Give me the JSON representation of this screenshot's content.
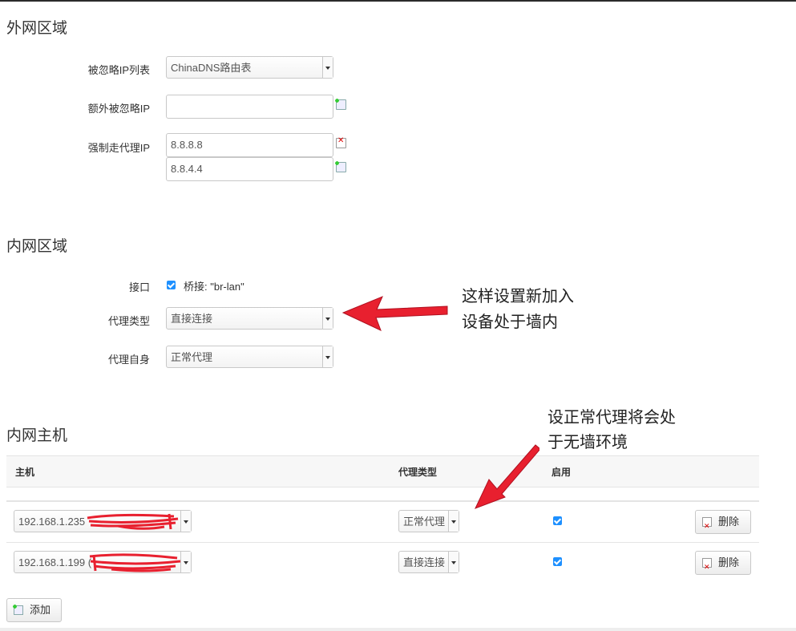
{
  "wan_zone": {
    "title": "外网区域",
    "ignored_ip_list_label": "被忽略IP列表",
    "ignored_ip_list_value": "ChinaDNS路由表",
    "extra_ignored_ip_label": "额外被忽略IP",
    "extra_ignored_ip_value": "",
    "force_proxy_ip_label": "强制走代理IP",
    "force_proxy_ips": [
      "8.8.8.8",
      "8.8.4.4"
    ]
  },
  "lan_zone": {
    "title": "内网区域",
    "interface_label": "接口",
    "interface_value": "桥接: \"br-lan\"",
    "proxy_type_label": "代理类型",
    "proxy_type_value": "直接连接",
    "proxy_self_label": "代理自身",
    "proxy_self_value": "正常代理"
  },
  "lan_hosts": {
    "title": "内网主机",
    "columns": [
      "主机",
      "代理类型",
      "启用"
    ],
    "rows": [
      {
        "host": "192.168.1.235",
        "proxy_type": "正常代理",
        "enabled": true,
        "delete_label": "删除"
      },
      {
        "host": "192.168.1.199 (",
        "proxy_type": "直接连接",
        "enabled": true,
        "delete_label": "删除"
      }
    ],
    "add_label": "添加"
  },
  "annotations": {
    "note1_line1": "这样设置新加入",
    "note1_line2": "设备处于墙内",
    "note2_line1": "设正常代理将会处",
    "note2_line2": "于无墙环境"
  },
  "colors": {
    "checkbox": "#1e90ff",
    "arrow": "#e8202f",
    "redaction": "#e8202f"
  }
}
